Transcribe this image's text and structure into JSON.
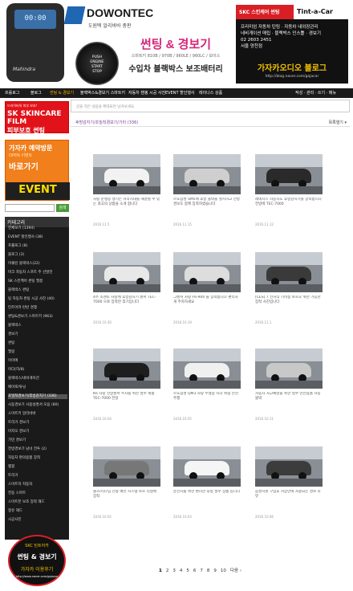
{
  "header": {
    "fob_display": "00:00",
    "fob_brand": "Mahindra",
    "logo_name": "DOWONTEC",
    "logo_sub": "도원텍 알리바바 총판",
    "start_btn": [
      "PUSH",
      "ENGINE",
      "START",
      "STOP"
    ],
    "headline": "썬팅 & 경보기",
    "models": "스마트키 810B / 970B / 960LE / 960LC / 보이스",
    "subline": "수입차 블랙박스 보조배터리",
    "ad_brand": "SKC 스킨케어 썬팅",
    "ad_right": "Tint-a-Car",
    "ad_phone": "02 2603 2451",
    "ad_sub": "서울 양천점",
    "ad_lines": [
      "프리미엄 자동차 틴팅 · 자동차 내외장관리",
      "네비게이션 매립 · 블랙박스 인스톨 · 경보기"
    ],
    "ad_cafe": "가자카오디오 블로그",
    "ad_url": "http://blog.naver.com/gajacar"
  },
  "nav": {
    "items": [
      "프롤로그",
      "블로그",
      "썬팅 & 경보기",
      "블랙박스&경보기 스마트키",
      "자동차 캠핑 시공 사진",
      "EVENT 할인행사",
      "레이나스 상품"
    ],
    "right": "작성 · 관리 · 쓰기 · 메뉴"
  },
  "side": {
    "skin_top": "드라이버의 피부 보호!",
    "skin_brand": "SK SKINCARE FILM",
    "skin_big": "피부보호 썬팅",
    "event_a": "가자카 예약방문",
    "event_b": "OPEN 이벤트",
    "event_c": "바로가기",
    "event_d": "EVENT",
    "search_btn": "검색",
    "cat_title": "카테고리",
    "cats": [
      "전체보기 (1394)",
      "EVENT 할인행사 (38)",
      "프롤로그 (8)",
      "블로그 (3)",
      "미쉐린 블랙박스(22)",
      "마크 자동차 스프트 주 선발전",
      "SK 스킨케어 썬팅 필름",
      "블랙박스 썬팅",
      "팅 자동차 썬팅 시공 사진 (40)",
      "틴트어카 탄탄 경쟁",
      "썬팅&경보기 스마트키 (963)",
      "블랙박스",
      "경보기",
      "썬팅",
      "필링",
      "이이에",
      "이디(하/8)",
      "블랙박스/네비게이션",
      "에어로/튜닝",
      "초밀착경보기/후방감지기 (336)",
      "시동경보기 사용설명서 모음 (80)",
      "스마트키 알리바바",
      "트리거 경보기",
      "이지오 경보기",
      "가민 경보기",
      "전방경보기 남녀 전투 (2)",
      "자동차 편의용품 장착",
      "랩핑",
      "트리거",
      "스마트하 자동차",
      "전동 스마트",
      "스마트폰 보조 장착 해드",
      "정유 해드",
      "시공사진"
    ],
    "badge": [
      "SKC 틴트어카",
      "썬팅 & 경보기",
      "가자카 이용후기",
      "http://www.naver.com/gajacar"
    ]
  },
  "main": {
    "note": "글을 적은 내용을 확대되면 남겨보세요.",
    "crumb": "후방감지기/초밀착경보기/기타 (336)",
    "sort": "목록열기 ▾",
    "posts": [
      {
        "desc": "차량 운행중 생기는 사각지대를 해결할 수 있는 최고의 상품을 소개 합니다",
        "date": "2016.11.5"
      },
      {
        "desc": "르노삼성 SM5에 후방 블박을 설치하고 전방 경보도 함께 장착하였습니다",
        "date": "2016.11.15"
      },
      {
        "desc": "레네시스 자동차도 후방감지기를 장착합니다 전방에 TEC-7000",
        "date": "2016.11.12"
      },
      {
        "desc": "4주 소렌토 차량에 후방감지기 센서 TEC-7000 으로 장착한 후기입니다",
        "date": "2016.10.30"
      },
      {
        "desc": "그랜져 차량 F6-900 을 장착합니다 편리하게 주차하세요",
        "date": "2016.10.19"
      },
      {
        "desc": "[CES] 7 전자식 기어봉 보호오 위한 가능한 장착 사진입니다",
        "date": "2016.11.1"
      },
      {
        "desc": "K6 차량 전방센서 주차를 위한 필수 제품 TEC-7000 전방",
        "date": "2016.10.04"
      },
      {
        "desc": "르노삼성 QM3 차량 주행중 사각 위험 안전주행",
        "date": "2016.10.05"
      },
      {
        "desc": "자동차 사고예방을 위한 필수 안전용품 자동 블박",
        "date": "2016.10.11"
      },
      {
        "desc": "볼츠/리나임 전용 배선 시스템 보조 리넬에 장착",
        "date": "2016.10.02"
      },
      {
        "desc": "운전자를 위한 편리한 후방 필수 상품 입니다",
        "date": "2016.10.03"
      },
      {
        "desc": "음성지원 구입후 저장안에 사용되는 경보 리뷰",
        "date": "2016.10.06"
      }
    ],
    "pager": [
      "1",
      "2",
      "3",
      "4",
      "5",
      "6",
      "7",
      "8",
      "9",
      "10",
      "다음 ›"
    ]
  }
}
